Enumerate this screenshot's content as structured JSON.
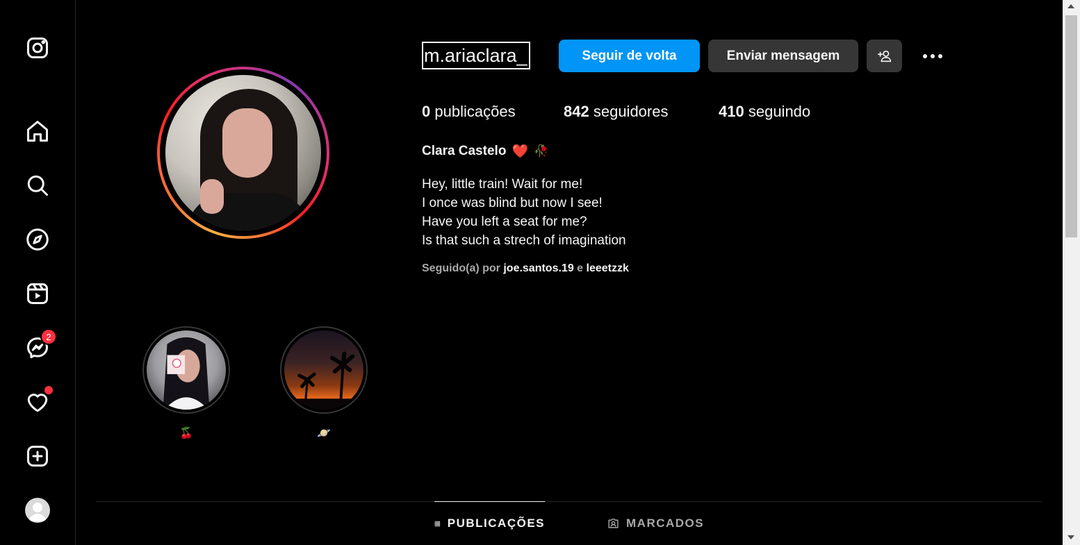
{
  "sidebar": {
    "messages_badge": "2",
    "icons": [
      "instagram-logo-icon",
      "home-icon",
      "search-icon",
      "explore-icon",
      "reels-icon",
      "messenger-icon",
      "heart-icon",
      "create-icon",
      "profile-avatar"
    ]
  },
  "profile": {
    "username": "m.ariaclara_",
    "follow_back_label": "Seguir de volta",
    "send_message_label": "Enviar mensagem",
    "stats": {
      "posts_count": "0",
      "posts_label": "publicações",
      "followers_count": "842",
      "followers_label": "seguidores",
      "following_count": "410",
      "following_label": "seguindo"
    },
    "full_name": "Clara Castelo",
    "full_name_emojis": [
      "❤️",
      "🥀"
    ],
    "bio_lines": [
      "Hey, little train! Wait for me!",
      "I once was blind but now I see!",
      "Have you left a seat for me?",
      "Is that such a strech of imagination"
    ],
    "followed_by_prefix": "Seguido(a) por",
    "followed_by_users": [
      "joe.santos.19",
      "leeetzzk"
    ],
    "followed_by_conjunction": "e"
  },
  "highlights": [
    {
      "label": "🍒"
    },
    {
      "label": "🪐"
    }
  ],
  "tabs": {
    "posts_label": "PUBLICAÇÕES",
    "tagged_label": "MARCADOS"
  },
  "colors": {
    "accent": "#0095f6",
    "secondary_button": "#363636",
    "badge": "#ff3040",
    "background": "#000000"
  }
}
